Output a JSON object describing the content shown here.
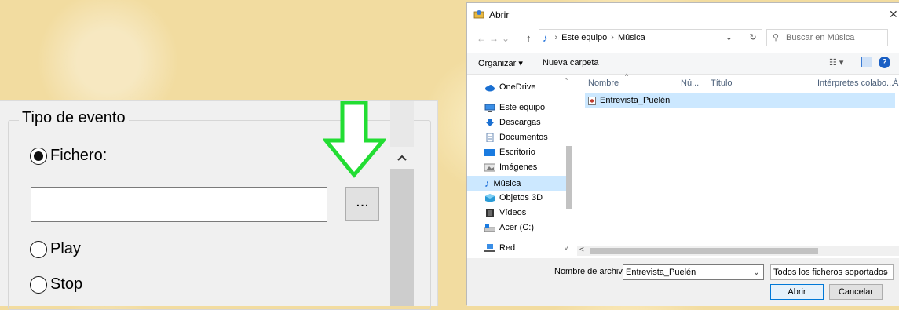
{
  "left_panel": {
    "group_title": "Tipo de evento",
    "option_file": "Fichero:",
    "option_play": "Play",
    "option_stop": "Stop",
    "file_value": "",
    "browse_label": "...",
    "selected_option": "Fichero:"
  },
  "dialog": {
    "title": "Abrir",
    "close_glyph": "✕",
    "breadcrumb": [
      "Este equipo",
      "Música"
    ],
    "search_placeholder": "Buscar en Música",
    "toolbar": {
      "organize": "Organizar ▾",
      "new_folder": "Nueva carpeta",
      "help": "?"
    },
    "nav_items": [
      {
        "label": "OneDrive",
        "icon": "cloud-icon"
      },
      {
        "label": "Este equipo",
        "icon": "computer-icon"
      },
      {
        "label": "Descargas",
        "icon": "download-icon"
      },
      {
        "label": "Documentos",
        "icon": "document-icon"
      },
      {
        "label": "Escritorio",
        "icon": "desktop-icon"
      },
      {
        "label": "Imágenes",
        "icon": "image-icon"
      },
      {
        "label": "Música",
        "icon": "music-icon"
      },
      {
        "label": "Objetos 3D",
        "icon": "cube-icon"
      },
      {
        "label": "Vídeos",
        "icon": "video-icon"
      },
      {
        "label": "Acer (C:)",
        "icon": "drive-icon"
      },
      {
        "label": "Red",
        "icon": "network-icon"
      }
    ],
    "selected_nav": "Música",
    "columns": [
      "Nombre",
      "Nú...",
      "Título",
      "Intérpretes colabo...",
      "Ál"
    ],
    "files": [
      {
        "name": "Entrevista_Puelén",
        "icon": "audio-file-icon"
      }
    ],
    "file_name_label": "Nombre de archivo:",
    "file_name_value": "Entrevista_Puelén",
    "file_type_value": "Todos los ficheros soportados",
    "open_button": "Abrir",
    "cancel_button": "Cancelar"
  },
  "colors": {
    "selection": "#cce8ff",
    "accent_blue": "#0078d7",
    "green_arrow": "#22dd33",
    "background": "#f2dca0"
  }
}
